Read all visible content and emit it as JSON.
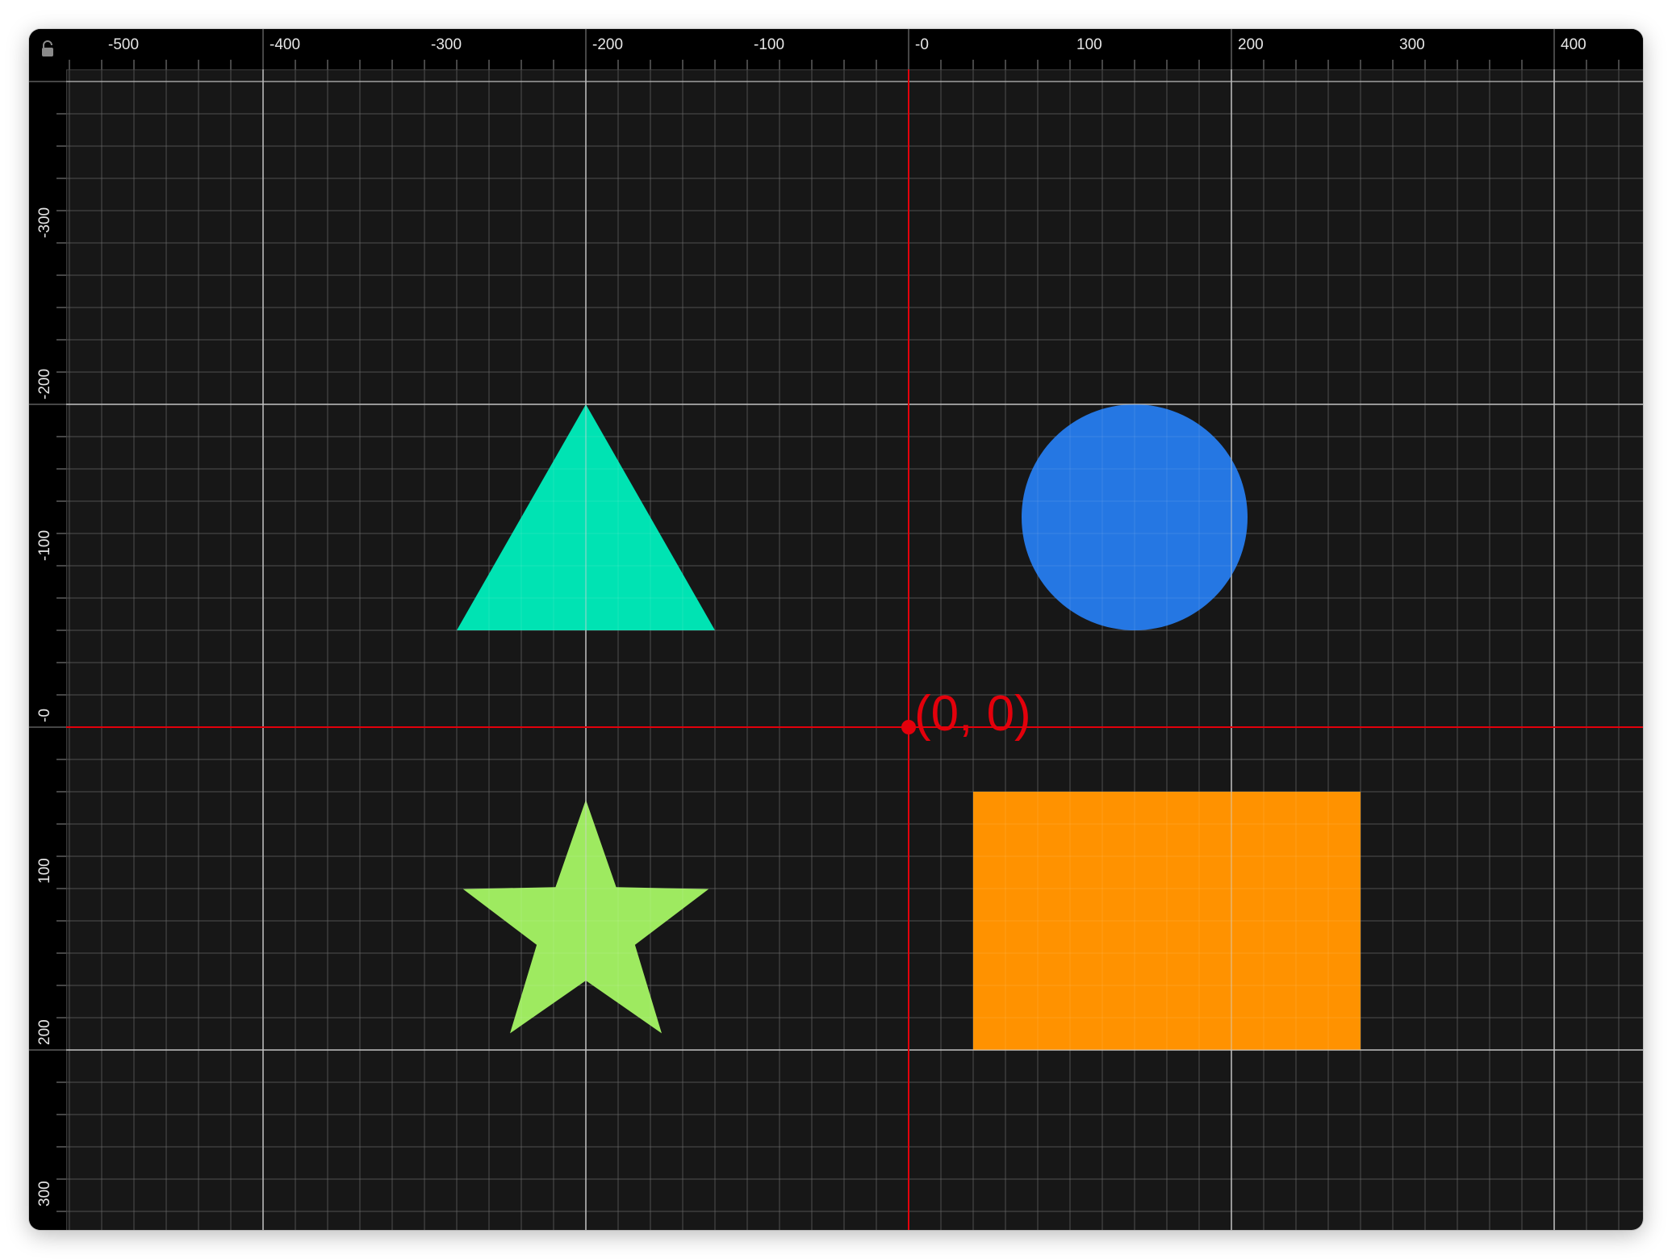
{
  "rulers": {
    "x_ticks": [
      -500,
      -400,
      -300,
      -200,
      -100,
      0,
      100,
      200,
      300,
      400
    ],
    "x_tick_labels": [
      "-500",
      "-400",
      "-300",
      "-200",
      "-100",
      "-0",
      "100",
      "200",
      "300",
      "400"
    ],
    "y_ticks": [
      -300,
      -200,
      -100,
      0,
      100,
      200,
      300
    ],
    "y_tick_labels": [
      "-300",
      "-200",
      "-100",
      "-0",
      "100",
      "200",
      "300"
    ]
  },
  "origin": {
    "label": "(0, 0)",
    "color": "#e3000b"
  },
  "colors": {
    "background": "#171717",
    "ruler": "#000000",
    "grid_minor": "#3b3b3b",
    "grid_major": "#9a9a9a",
    "axis": "#e3000b"
  },
  "shapes": [
    {
      "kind": "triangle",
      "color": "#00e3b3",
      "apex": [
        -200,
        -200
      ],
      "base_left": [
        -280,
        -60
      ],
      "base_right": [
        -120,
        -60
      ]
    },
    {
      "kind": "circle",
      "color": "#2577e3",
      "center": [
        140,
        -130
      ],
      "radius": 70
    },
    {
      "kind": "star",
      "color": "#9eea60",
      "center": [
        -200,
        125
      ],
      "outer_radius": 80,
      "inner_radius": 32
    },
    {
      "kind": "rectangle",
      "color": "#ff9200",
      "x_range": [
        40,
        280
      ],
      "y_range": [
        40,
        200
      ]
    }
  ],
  "icons": {
    "corner": "lock-icon"
  }
}
